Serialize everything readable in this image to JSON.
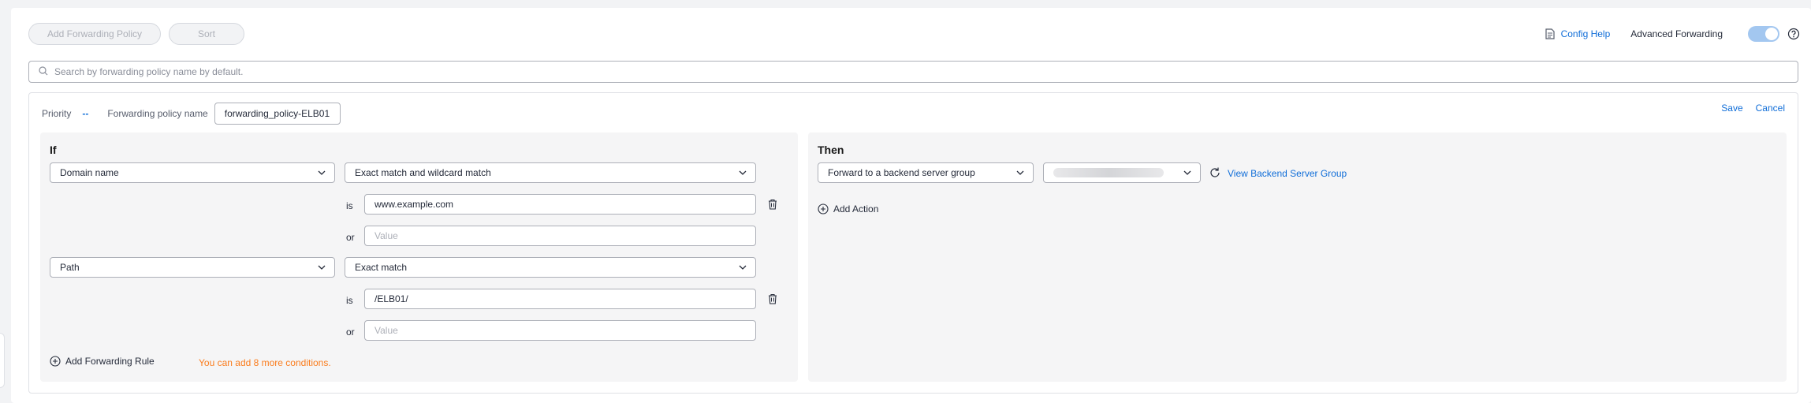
{
  "toolbar": {
    "add_policy_label": "Add Forwarding Policy",
    "sort_label": "Sort",
    "config_help_label": "Config Help",
    "advanced_forwarding_label": "Advanced Forwarding",
    "advanced_forwarding_enabled": true
  },
  "search": {
    "placeholder": "Search by forwarding policy name by default."
  },
  "policy": {
    "priority_label": "Priority",
    "priority_value": "--",
    "name_label": "Forwarding policy name",
    "name_value": "forwarding_policy-ELB01",
    "save_label": "Save",
    "cancel_label": "Cancel"
  },
  "if_panel": {
    "title": "If",
    "rules": [
      {
        "type": "Domain name",
        "match": "Exact match and wildcard match",
        "is_label": "is",
        "is_value": "www.example.com",
        "or_label": "or",
        "or_placeholder": "Value"
      },
      {
        "type": "Path",
        "match": "Exact match",
        "is_label": "is",
        "is_value": "/ELB01/",
        "or_label": "or",
        "or_placeholder": "Value"
      }
    ],
    "add_rule_label": "Add Forwarding Rule",
    "hint": "You can add 8 more conditions."
  },
  "then_panel": {
    "title": "Then",
    "action": "Forward to a backend server group",
    "view_group_label": "View Backend Server Group",
    "add_action_label": "Add Action"
  },
  "colors": {
    "accent": "#0f6dd8",
    "warning": "#fa7d1e",
    "panel_bg": "#f5f5f6"
  }
}
